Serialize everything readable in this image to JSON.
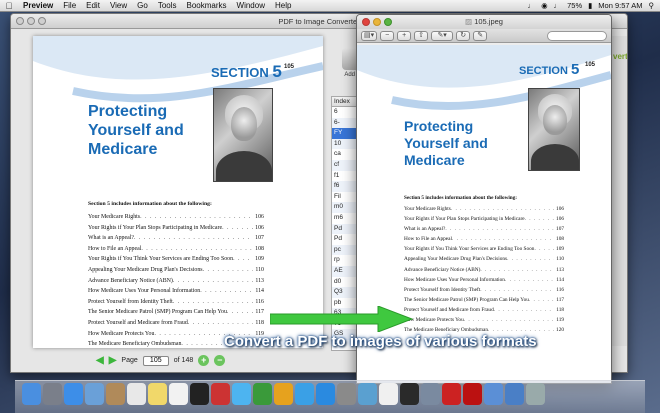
{
  "menubar": {
    "app": "Preview",
    "items": [
      "File",
      "Edit",
      "View",
      "Go",
      "Tools",
      "Bookmarks",
      "Window",
      "Help"
    ],
    "battery": "75%",
    "clock": "Mon 9:57 AM"
  },
  "back_window": {
    "title": "PDF to Image Converter",
    "toolbar_label": "Add Fi",
    "index_header": "Index",
    "index_rows": [
      "6",
      "6-",
      "FY",
      "10",
      "ca",
      "cf",
      "f1",
      "f6",
      "Fil",
      "m0",
      "m6",
      "Pd",
      "Pd",
      "pc",
      "rp",
      "AE",
      "d0",
      "Q3",
      "pb",
      "63",
      "75",
      "GS",
      "HM",
      "QS"
    ],
    "convert_label": "vert",
    "page_label": "Page",
    "page_value": "105",
    "page_total": "of 148"
  },
  "front_window": {
    "title": "105.jpeg"
  },
  "document": {
    "section": "SECTION",
    "section_num": "5",
    "page_number": "105",
    "heading": "Protecting\nYourself and\nMedicare",
    "intro": "Section 5 includes information about the following:",
    "toc": [
      {
        "title": "Your Medicare Rights",
        "page": "106"
      },
      {
        "title": "Your Rights if Your Plan Stops Participating in Medicare",
        "page": "106"
      },
      {
        "title": "What is an Appeal?",
        "page": "107"
      },
      {
        "title": "How to File an Appeal",
        "page": "108"
      },
      {
        "title": "Your Rights if You Think Your Services are Ending Too Soon",
        "page": "109"
      },
      {
        "title": "Appealing Your Medicare Drug Plan's Decisions",
        "page": "110"
      },
      {
        "title": "Advance Beneficiary Notice (ABN)",
        "page": "113"
      },
      {
        "title": "How Medicare Uses Your Personal Information",
        "page": "114"
      },
      {
        "title": "Protect Yourself from Identity Theft",
        "page": "116"
      },
      {
        "title": "The Senior Medicare Patrol (SMP) Program Can Help You",
        "page": "117"
      },
      {
        "title": "Protect Yourself and Medicare from Fraud",
        "page": "118"
      },
      {
        "title": "How Medicare Protects You",
        "page": "119"
      },
      {
        "title": "The Medicare Beneficiary Ombudsman",
        "page": "120"
      }
    ]
  },
  "overlay": {
    "banner": "Convert a PDF to images of various formats",
    "arrow_color": "#3fc83f"
  },
  "dock": {
    "icons": [
      "finder-icon",
      "launchpad-icon",
      "safari-icon",
      "mail-icon",
      "contacts-icon",
      "calendar-icon",
      "notes-icon",
      "reminders-icon",
      "terminal-icon",
      "photo-booth-icon",
      "messages-icon",
      "facetime-icon",
      "photos-icon",
      "itunes-icon",
      "app-store-icon",
      "system-prefs-icon",
      "preview-icon",
      "textedit-icon",
      "activity-monitor-icon",
      "utilities-icon",
      "pdf-converter-icon",
      "acrobat-icon",
      "folder-icon",
      "downloads-icon",
      "trash-icon"
    ]
  }
}
